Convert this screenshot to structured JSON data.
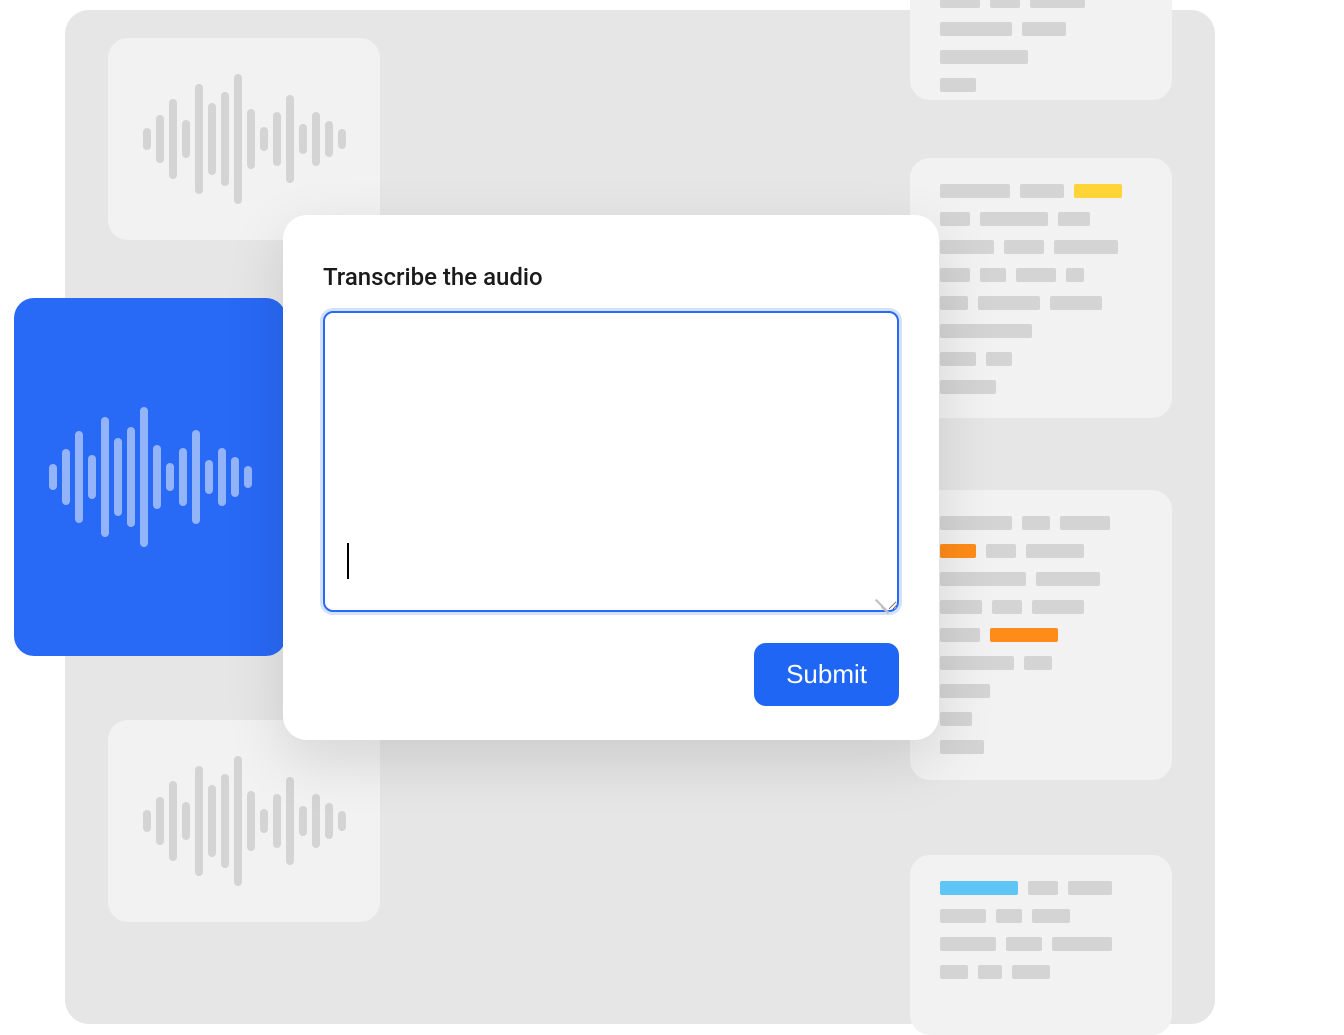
{
  "modal": {
    "label": "Transcribe the audio",
    "textarea_value": "",
    "submit_label": "Submit"
  },
  "colors": {
    "primary_blue": "#2869f5",
    "highlight_yellow": "#ffd436",
    "highlight_orange": "#ff8c18",
    "highlight_blue": "#5ec5f5"
  }
}
